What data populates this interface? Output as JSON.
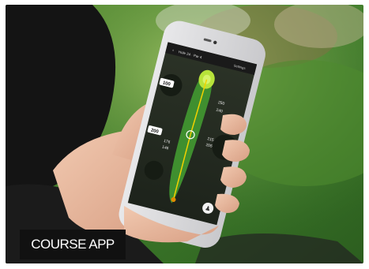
{
  "badge": {
    "text": "COURSE APP"
  },
  "app": {
    "hole_header": "Hole 24 · Par 4",
    "header_right": "Settings",
    "yardage_labels": [
      "100",
      "200"
    ],
    "left_numbers": [
      "176",
      "146"
    ],
    "right_numbers": [
      "250",
      "240",
      "215",
      "205"
    ],
    "icons": [
      "back-arrow-icon",
      "settings-icon",
      "flag-pin-icon",
      "golfer-icon"
    ]
  },
  "colors": {
    "fairway": "#3f8f2f",
    "green": "#b7e33a",
    "route_line": "#f2d100",
    "badge_bg": "#111111"
  }
}
